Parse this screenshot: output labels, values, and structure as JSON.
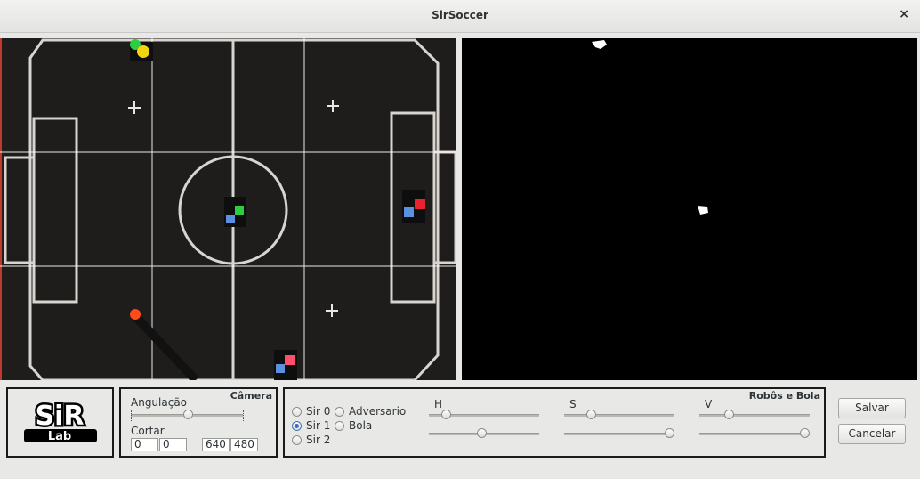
{
  "window": {
    "title": "SirSoccer",
    "close_label": "×"
  },
  "logo": {
    "line1": "SiR",
    "line2": "Lab"
  },
  "camera_panel": {
    "title": "Câmera",
    "angulacao_label": "Angulação",
    "angulacao_value": 0.5,
    "cortar_label": "Cortar",
    "crop": [
      "0",
      "0",
      "640",
      "480"
    ]
  },
  "robots_panel": {
    "title": "Robôs e Bola",
    "radios": [
      {
        "label": "Sir 0",
        "checked": false
      },
      {
        "label": "Adversario",
        "checked": false
      },
      {
        "label": "Sir 1",
        "checked": true
      },
      {
        "label": "Bola",
        "checked": false
      },
      {
        "label": "Sir 2",
        "checked": false
      }
    ],
    "channels": [
      {
        "label": "H",
        "min": 0.15,
        "max": 0.47
      },
      {
        "label": "S",
        "min": 0.24,
        "max": 0.93
      },
      {
        "label": "V",
        "min": 0.27,
        "max": 0.93
      }
    ]
  },
  "buttons": {
    "save": "Salvar",
    "cancel": "Cancelar"
  },
  "colors": {
    "accent": "#3b73b9",
    "field_bg": "#1f1d1c",
    "mask_bg": "#000000"
  }
}
